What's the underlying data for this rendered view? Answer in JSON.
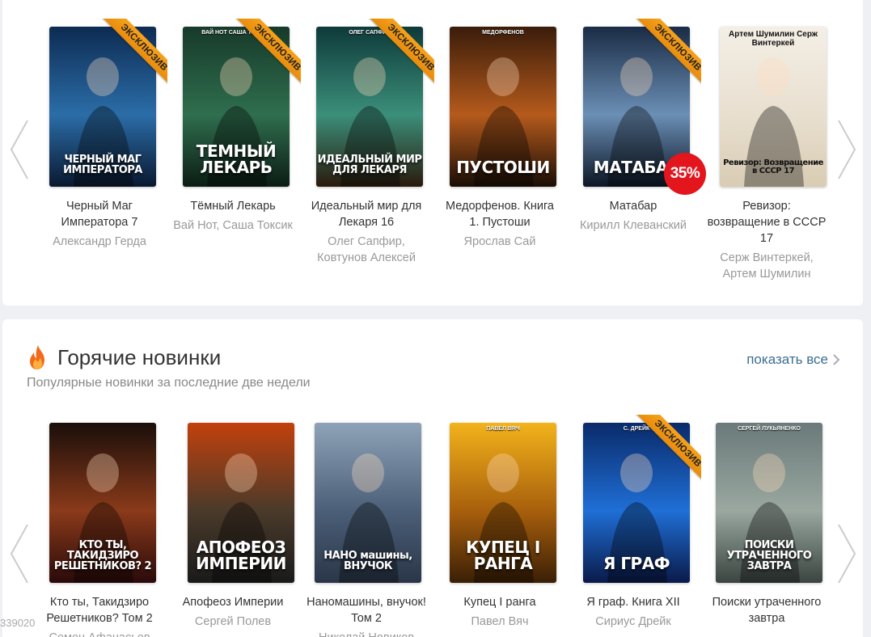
{
  "carousel_top": {
    "books": [
      {
        "title": "Черный Маг Императора 7",
        "authors": [
          "Александр Герда"
        ],
        "exclusive": true,
        "cover_text": "ЧЕРНЫЙ МАГ ИМПЕРАТОРА",
        "cover_top": "",
        "cover_colors": [
          "#0d2b52",
          "#2b6da8",
          "#0a1830"
        ]
      },
      {
        "title": "Тёмный Лекарь",
        "authors": [
          "Вай Нот, Саша Токсик"
        ],
        "exclusive": true,
        "cover_text": "ТЕМНЫЙ ЛЕКАРЬ",
        "cover_top": "ВАЙ НОТ САША ТОКСИК",
        "cover_colors": [
          "#173a2a",
          "#2f6e4e",
          "#0b1c14"
        ]
      },
      {
        "title": "Идеальный мир для Лекаря 16",
        "authors": [
          "Олег Сапфир,",
          "Ковтунов Алексей"
        ],
        "exclusive": true,
        "cover_text": "ИДЕАЛЬНЫЙ МИР ДЛЯ ЛЕКАРЯ",
        "cover_top": "ОЛЕГ САПФИР",
        "cover_colors": [
          "#0e3a3a",
          "#3b8f7a",
          "#2a1a0c"
        ]
      },
      {
        "title": "Медорфенов. Книга 1. Пустоши",
        "authors": [
          "Ярослав Сай"
        ],
        "exclusive": false,
        "cover_text": "ПУСТОШИ",
        "cover_top": "МЕДОРФЕНОВ",
        "cover_colors": [
          "#3a1c0a",
          "#b55a1c",
          "#1a0e06"
        ]
      },
      {
        "title": "Матабар",
        "authors": [
          "Кирилл Клеванский"
        ],
        "exclusive": true,
        "discount": "35%",
        "cover_text": "МАТАБАР",
        "cover_top": "",
        "cover_colors": [
          "#1a2c45",
          "#6b8fb5",
          "#0c1626"
        ]
      },
      {
        "title": "Ревизор: возвращение в СССР 17",
        "authors": [
          "Серж Винтеркей,",
          "Артем Шумилин"
        ],
        "exclusive": false,
        "cover_text": "Ревизор: Возвращение в СССР 17",
        "cover_top": "Артем Шумилин Серж Винтеркей",
        "cover_colors": [
          "#f4efe6",
          "#e8dfcf",
          "#d9ccb4"
        ]
      }
    ]
  },
  "hot_new": {
    "title": "Горячие новинки",
    "subtitle": "Популярные новинки за последние две недели",
    "show_all": "показать все",
    "books": [
      {
        "title": "Кто ты, Такидзиро Решетников? Том 2",
        "authors": [
          "Семен Афанасьев"
        ],
        "exclusive": false,
        "cover_text": "КТО ТЫ, ТАКИДЗИРО РЕШЕТНИКОВ? 2",
        "cover_top": "",
        "cover_colors": [
          "#1a0e0a",
          "#8a3a1a",
          "#2a0a0a"
        ]
      },
      {
        "title": "Апофеоз Империи",
        "authors": [
          "Сергей Полев"
        ],
        "exclusive": false,
        "cover_text": "АПОФЕОЗ ИМПЕРИИ",
        "cover_top": "",
        "cover_colors": [
          "#c2410c",
          "#4a3a2a",
          "#1a1a1a"
        ]
      },
      {
        "title": "Наномашины, внучок! Том 2",
        "authors": [
          "Николай Новиков"
        ],
        "exclusive": false,
        "cover_text": "НАНО машины, ВНУЧОК",
        "cover_top": "",
        "cover_colors": [
          "#8ea3b8",
          "#4b5f78",
          "#2a3648"
        ]
      },
      {
        "title": "Купец I ранга",
        "authors": [
          "Павел Вяч"
        ],
        "exclusive": false,
        "cover_text": "КУПЕЦ I РАНГА",
        "cover_top": "ПАВЕЛ ВЯЧ",
        "cover_colors": [
          "#f2b31b",
          "#a85f0c",
          "#3a1f06"
        ]
      },
      {
        "title": "Я граф. Книга XII",
        "authors": [
          "Сириус Дрейк"
        ],
        "exclusive": true,
        "cover_text": "Я ГРАФ",
        "cover_top": "С. ДРЕЙК",
        "cover_colors": [
          "#0a2a6a",
          "#1f6fd6",
          "#0a1a4a"
        ]
      },
      {
        "title": "Поиски утраченного завтра",
        "authors": [
          ""
        ],
        "exclusive": false,
        "cover_text": "ПОИСКИ УТРАЧЕННОГО ЗАВТРА",
        "cover_top": "СЕРГЕЙ ЛУКЬЯНЕНКО",
        "cover_colors": [
          "#6a7a7a",
          "#9aa8a0",
          "#3a4440"
        ]
      }
    ]
  },
  "exclusive_label": "ЭКСКЛЮЗИВ",
  "corner_id": "339020",
  "colors": {
    "accent_link": "#3b6e93",
    "ribbon": "#f39a18",
    "discount": "#e3151d",
    "fire": "#f26b1d"
  }
}
